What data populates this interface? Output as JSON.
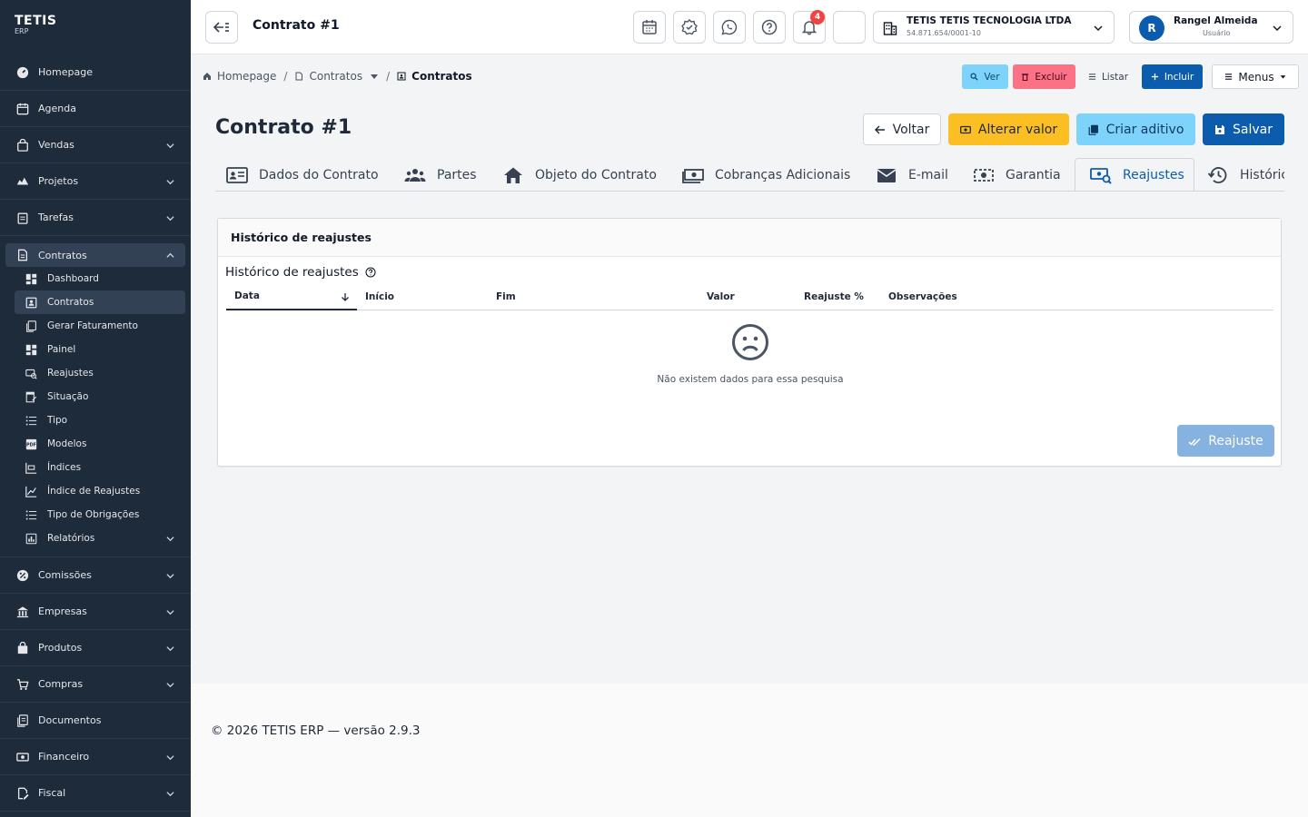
{
  "brand": {
    "name": "TETIS",
    "sub": "ERP"
  },
  "sidebar": {
    "items_top": [
      {
        "label": "Homepage",
        "icon": "home-gauge-icon"
      },
      {
        "label": "Agenda",
        "icon": "calendar-icon"
      },
      {
        "label": "Vendas",
        "icon": "shopping-bag-icon"
      },
      {
        "label": "Projetos",
        "icon": "tree-icon"
      },
      {
        "label": "Tarefas",
        "icon": "clipboard-icon"
      }
    ],
    "contratos": {
      "label": "Contratos",
      "icon": "document-icon"
    },
    "sub_items": [
      {
        "label": "Dashboard"
      },
      {
        "label": "Contratos"
      },
      {
        "label": "Gerar Faturamento"
      },
      {
        "label": "Painel"
      },
      {
        "label": "Reajustes"
      },
      {
        "label": "Situação"
      },
      {
        "label": "Tipo"
      },
      {
        "label": "Modelos"
      },
      {
        "label": "Índices"
      },
      {
        "label": "Índice de Reajustes"
      },
      {
        "label": "Tipo de Obrigações"
      },
      {
        "label": "Relatórios"
      }
    ],
    "items_bottom": [
      {
        "label": "Comissões"
      },
      {
        "label": "Empresas"
      },
      {
        "label": "Produtos"
      },
      {
        "label": "Compras"
      },
      {
        "label": "Documentos"
      },
      {
        "label": "Financeiro"
      },
      {
        "label": "Fiscal"
      }
    ]
  },
  "topbar": {
    "title": "Contrato #1",
    "notifications_count": "4",
    "company": {
      "name": "TETIS TETIS TECNOLOGIA LTDA",
      "cnpj": "54.871.654/0001-10"
    },
    "user": {
      "initial": "R",
      "name": "Rangel Almeida",
      "role": "Usuário"
    }
  },
  "breadcrumb": {
    "home": "Homepage",
    "parent": "Contratos",
    "current": "Contratos"
  },
  "actions": {
    "ver": "Ver",
    "excluir": "Excluir",
    "listar": "Listar",
    "incluir": "Incluir",
    "menus": "Menus"
  },
  "page": {
    "title": "Contrato #1",
    "buttons": {
      "voltar": "Voltar",
      "alterar": "Alterar valor",
      "aditivo": "Criar aditivo",
      "salvar": "Salvar"
    }
  },
  "tabs": [
    {
      "label": "Dados do Contrato"
    },
    {
      "label": "Partes"
    },
    {
      "label": "Objeto do Contrato"
    },
    {
      "label": "Cobranças Adicionais"
    },
    {
      "label": "E-mail"
    },
    {
      "label": "Garantia"
    },
    {
      "label": "Reajustes"
    },
    {
      "label": "Histórico"
    }
  ],
  "card": {
    "header": "Histórico de reajustes",
    "section_title": "Histórico de reajustes",
    "columns": [
      "Data",
      "Início",
      "Fim",
      "Valor",
      "Reajuste %",
      "Observações"
    ],
    "empty_text": "Não existem dados para essa pesquisa",
    "button": "Reajuste"
  },
  "colors": {
    "sidebar": "#1d2b3a",
    "primary": "#0b5cad",
    "warning": "#fbbf24",
    "info": "#7dd3fc",
    "danger": "#fb7185"
  },
  "footer": "© 2026 TETIS ERP — versão 2.9.3"
}
